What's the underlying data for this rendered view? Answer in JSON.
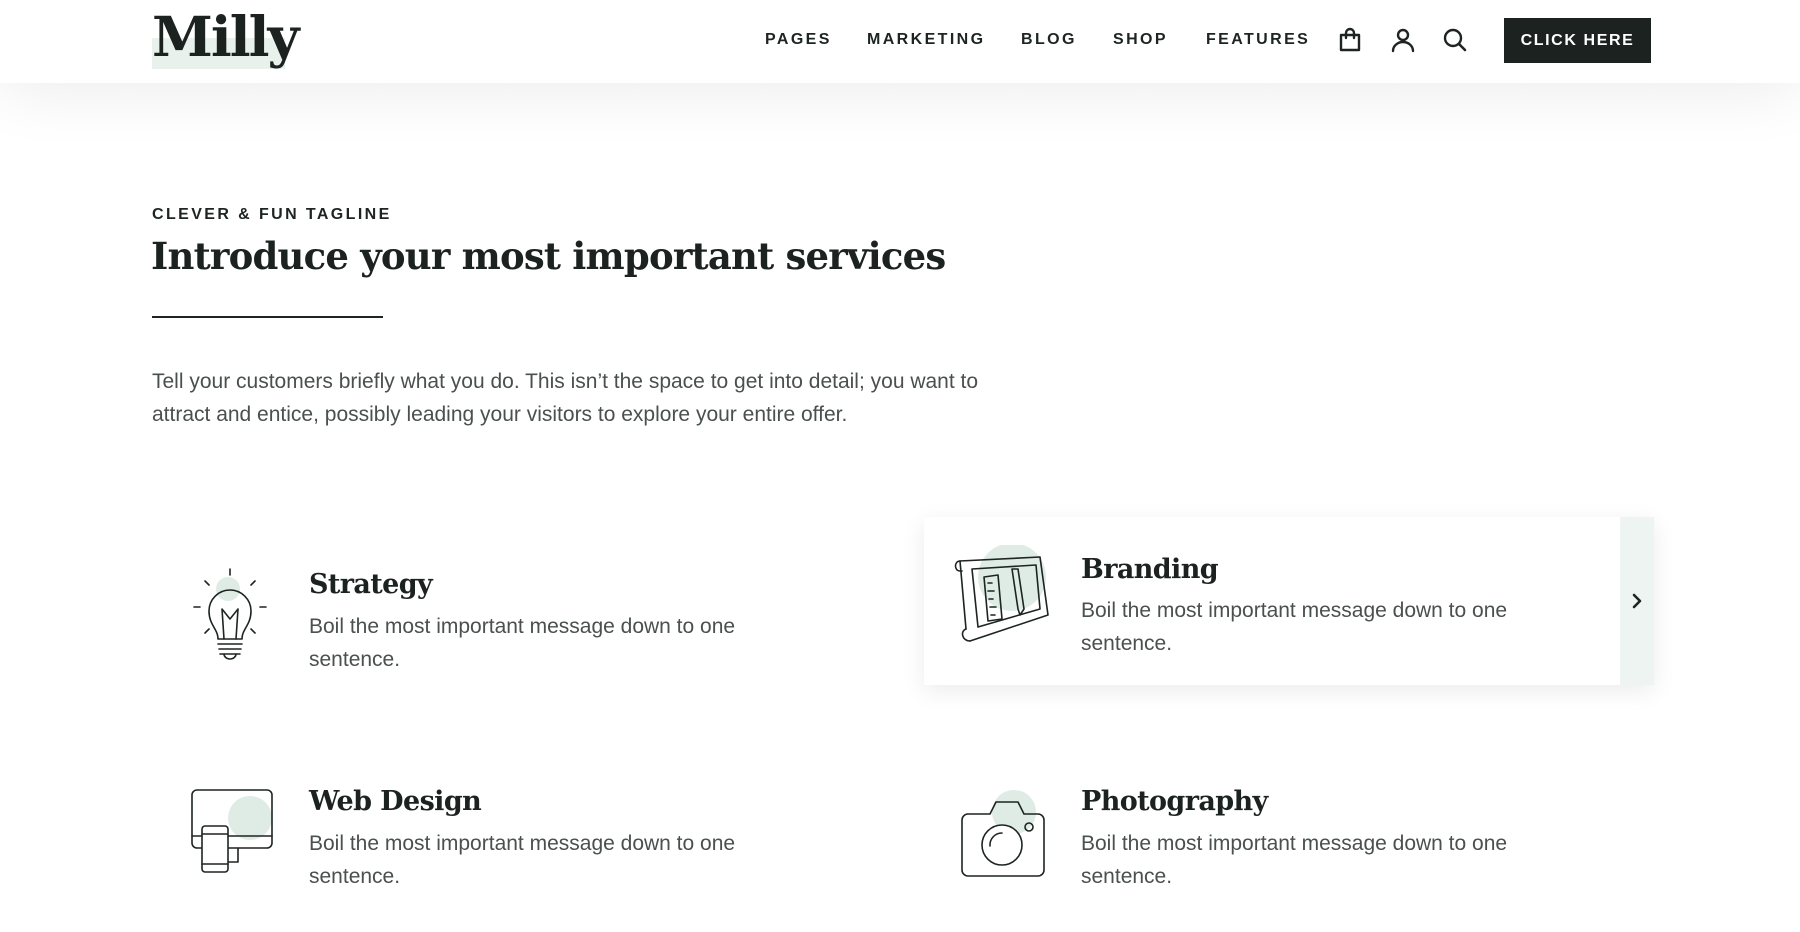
{
  "header": {
    "logo": "Milly",
    "nav": [
      "PAGES",
      "MARKETING",
      "BLOG",
      "SHOP",
      "FEATURES"
    ],
    "icons": [
      "shopping-bag-icon",
      "user-icon",
      "search-icon"
    ],
    "cta_label": "CLICK HERE"
  },
  "intro": {
    "tagline": "CLEVER & FUN TAGLINE",
    "title": "Introduce your most important services",
    "description": "Tell your customers briefly what you do. This isn’t the space to get into detail; you want to attract and entice, possibly leading your visitors to explore your entire offer."
  },
  "services": [
    {
      "title": "Strategy",
      "description": "Boil the most important message down to one sentence.",
      "icon": "lightbulb-icon"
    },
    {
      "title": "Branding",
      "description": "Boil the most important message down to one sentence.",
      "icon": "blueprint-icon"
    },
    {
      "title": "Web Design",
      "description": "Boil the most important message down to one sentence.",
      "icon": "devices-icon"
    },
    {
      "title": "Photography",
      "description": "Boil the most important message down to one sentence.",
      "icon": "camera-icon"
    }
  ],
  "colors": {
    "text": "#1b2220",
    "body_text": "#4a504e",
    "accent_mint": "#dfece5",
    "cta_bg": "#1b2220"
  }
}
